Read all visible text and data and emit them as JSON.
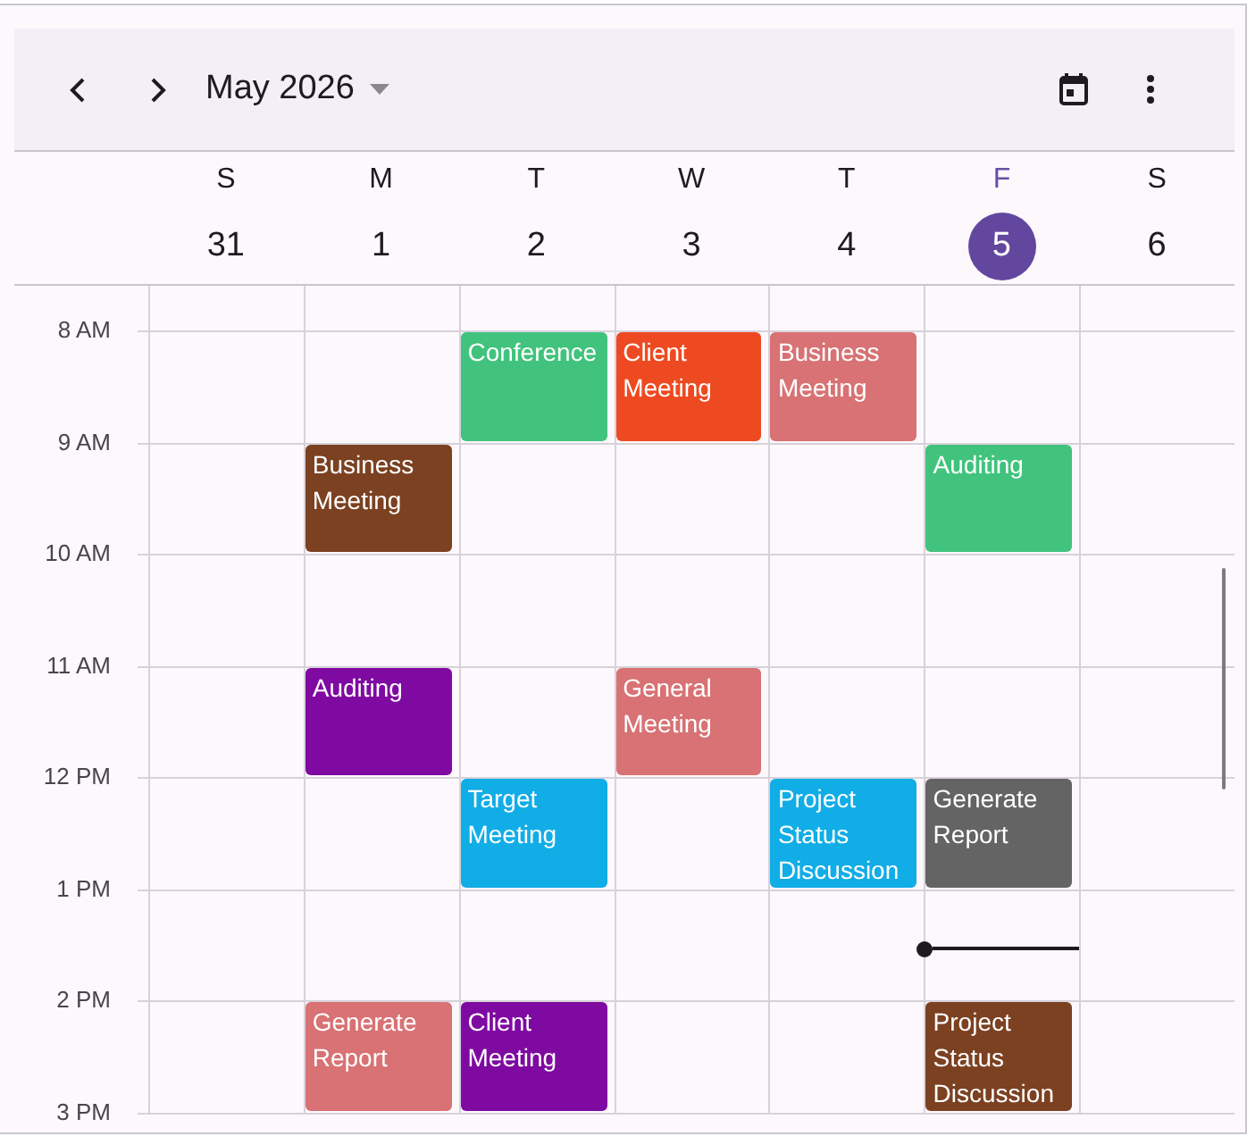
{
  "toolbar": {
    "title": "May 2026"
  },
  "days": [
    {
      "weekday": "S",
      "date": "31",
      "today": false
    },
    {
      "weekday": "M",
      "date": "1",
      "today": false
    },
    {
      "weekday": "T",
      "date": "2",
      "today": false
    },
    {
      "weekday": "W",
      "date": "3",
      "today": false
    },
    {
      "weekday": "T",
      "date": "4",
      "today": false
    },
    {
      "weekday": "F",
      "date": "5",
      "today": true
    },
    {
      "weekday": "S",
      "date": "6",
      "today": false
    }
  ],
  "time_slots": [
    {
      "label": "8 AM",
      "cells": [
        null,
        null,
        {
          "kind": "event",
          "title": "Conference",
          "color": "#41c37d"
        },
        {
          "kind": "event",
          "title": "Client Meeting",
          "color": "#ee4a21"
        },
        {
          "kind": "event",
          "title": "Business Meeting",
          "color": "#d87274"
        },
        null,
        null
      ]
    },
    {
      "label": "9 AM",
      "cells": [
        null,
        {
          "kind": "event",
          "title": "Business Meeting",
          "color": "#7b4121"
        },
        null,
        null,
        null,
        {
          "kind": "event",
          "title": "Auditing",
          "color": "#41c37d"
        },
        null
      ]
    },
    {
      "label": "10 AM",
      "cells": [
        null,
        null,
        null,
        null,
        null,
        null,
        null
      ]
    },
    {
      "label": "11 AM",
      "cells": [
        null,
        {
          "kind": "event",
          "title": "Auditing",
          "color": "#7f0aa1"
        },
        null,
        {
          "kind": "event",
          "title": "General Meeting",
          "color": "#d87274"
        },
        null,
        null,
        null
      ]
    },
    {
      "label": "12 PM",
      "cells": [
        null,
        null,
        {
          "kind": "event",
          "title": "Target Meeting",
          "color": "#11ade6"
        },
        null,
        {
          "kind": "event",
          "title": "Project Status Discussion",
          "color": "#11ade6"
        },
        {
          "kind": "event",
          "title": "Generate Report",
          "color": "#646464"
        },
        null
      ]
    },
    {
      "label": "1 PM",
      "cells": [
        null,
        null,
        null,
        null,
        null,
        {
          "kind": "current_time"
        },
        null
      ]
    },
    {
      "label": "2 PM",
      "cells": [
        null,
        {
          "kind": "event",
          "title": "Generate Report",
          "color": "#d87274"
        },
        {
          "kind": "event",
          "title": "Client Meeting",
          "color": "#7f0aa1"
        },
        null,
        null,
        {
          "kind": "event",
          "title": "Project Status Discussion",
          "color": "#7b4121"
        },
        null
      ]
    },
    {
      "label": "3 PM"
    }
  ]
}
